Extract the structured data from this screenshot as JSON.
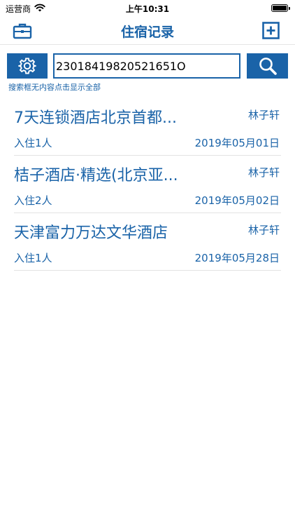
{
  "status_bar": {
    "carrier": "运营商",
    "time": "上午10:31"
  },
  "nav": {
    "title": "住宿记录",
    "left_icon": "briefcase-icon",
    "right_icon": "plus-square-icon"
  },
  "search": {
    "value": "23018419820521651O",
    "hint": "搜索框无内容点击显示全部",
    "settings_icon": "gear-icon",
    "search_icon": "magnifier-icon"
  },
  "records": [
    {
      "hotel": "7天连锁酒店北京首都...",
      "guest": "林子轩",
      "people": "入住1人",
      "date": "2019年05月01日"
    },
    {
      "hotel": "桔子酒店·精选(北京亚...",
      "guest": "林子轩",
      "people": "入住2人",
      "date": "2019年05月02日"
    },
    {
      "hotel": "天津富力万达文华酒店",
      "guest": "林子轩",
      "people": "入住1人",
      "date": "2019年05月28日"
    }
  ],
  "colors": {
    "accent": "#1a63a8",
    "divider": "#e2e2e2"
  }
}
